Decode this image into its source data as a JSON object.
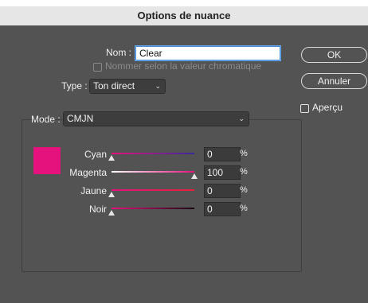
{
  "title": "Options de nuance",
  "name": {
    "label": "Nom :",
    "value": "Clear"
  },
  "name_by_color": {
    "label": "Nommer selon la valeur chromatique",
    "checked": false
  },
  "type": {
    "label": "Type :",
    "value": "Ton direct"
  },
  "mode": {
    "label": "Mode :",
    "value": "CMJN"
  },
  "buttons": {
    "ok": "OK",
    "cancel": "Annuler"
  },
  "preview": {
    "label": "Aperçu",
    "checked": false
  },
  "swatch_color": "#e5127d",
  "channels": [
    {
      "label": "Cyan",
      "value": "0",
      "unit": "%",
      "level": 0.0,
      "grad": "linear-gradient(to right,#e5127d,#3b2a9a)"
    },
    {
      "label": "Magenta",
      "value": "100",
      "unit": "%",
      "level": 1.0,
      "grad": "linear-gradient(to right,#ffffff,#e5127d)"
    },
    {
      "label": "Jaune",
      "value": "0",
      "unit": "%",
      "level": 0.0,
      "grad": "linear-gradient(to right,#e5127d,#e8203a)"
    },
    {
      "label": "Noir",
      "value": "0",
      "unit": "%",
      "level": 0.0,
      "grad": "linear-gradient(to right,#e5127d,#1a0a12)"
    }
  ]
}
